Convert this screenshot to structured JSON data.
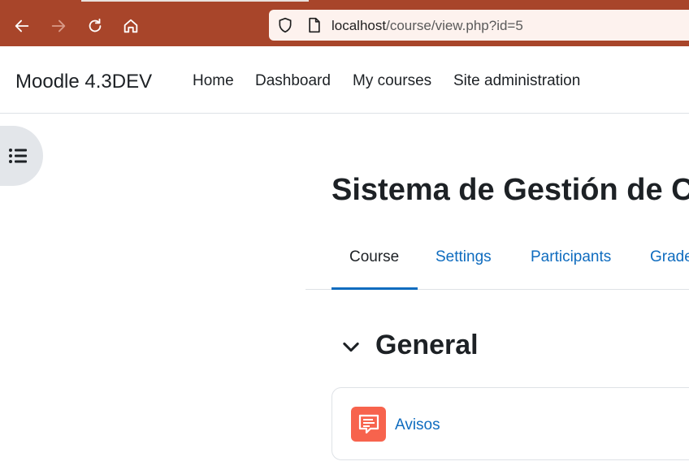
{
  "browser": {
    "url_host": "localhost",
    "url_path": "/course/view.php?id=5"
  },
  "site": {
    "brand": "Moodle 4.3DEV",
    "nav": [
      {
        "label": "Home"
      },
      {
        "label": "Dashboard"
      },
      {
        "label": "My courses"
      },
      {
        "label": "Site administration"
      }
    ]
  },
  "course": {
    "title": "Sistema de Gestión de C",
    "tabs": [
      {
        "label": "Course",
        "active": true
      },
      {
        "label": "Settings"
      },
      {
        "label": "Participants"
      },
      {
        "label": "Grades"
      }
    ]
  },
  "section": {
    "title": "General",
    "activities": [
      {
        "name": "Avisos",
        "icon": "forum-icon"
      }
    ]
  },
  "colors": {
    "browser_bar": "#a8452a",
    "link": "#0f6cbf",
    "forum_icon_bg": "#f7634d"
  }
}
